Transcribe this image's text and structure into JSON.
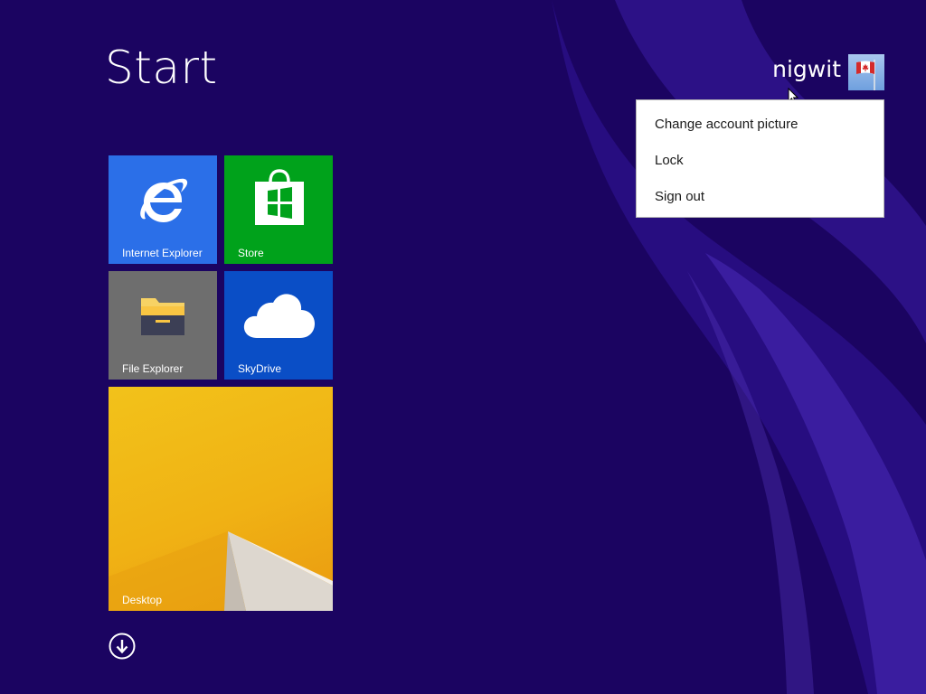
{
  "start": {
    "title": "Start"
  },
  "user": {
    "name": "nigwit",
    "avatar_icon": "canadian-flag-icon"
  },
  "account_menu": {
    "items": [
      {
        "label": "Change account picture"
      },
      {
        "label": "Lock"
      },
      {
        "label": "Sign out"
      }
    ]
  },
  "tiles": [
    {
      "label": "Internet Explorer",
      "icon": "internet-explorer-icon",
      "color": "#2b6fe8"
    },
    {
      "label": "Store",
      "icon": "store-bag-icon",
      "color": "#00a21b"
    },
    {
      "label": "File Explorer",
      "icon": "folder-icon",
      "color": "#6e6e6e"
    },
    {
      "label": "SkyDrive",
      "icon": "cloud-icon",
      "color": "#0a4ec6"
    },
    {
      "label": "Desktop",
      "icon": "desktop-wallpaper",
      "color": "#f0b214"
    }
  ],
  "all_apps": {
    "icon": "arrow-down-circle-icon"
  },
  "colors": {
    "background": "#1b0461",
    "swoosh": "#3f1fa0"
  }
}
